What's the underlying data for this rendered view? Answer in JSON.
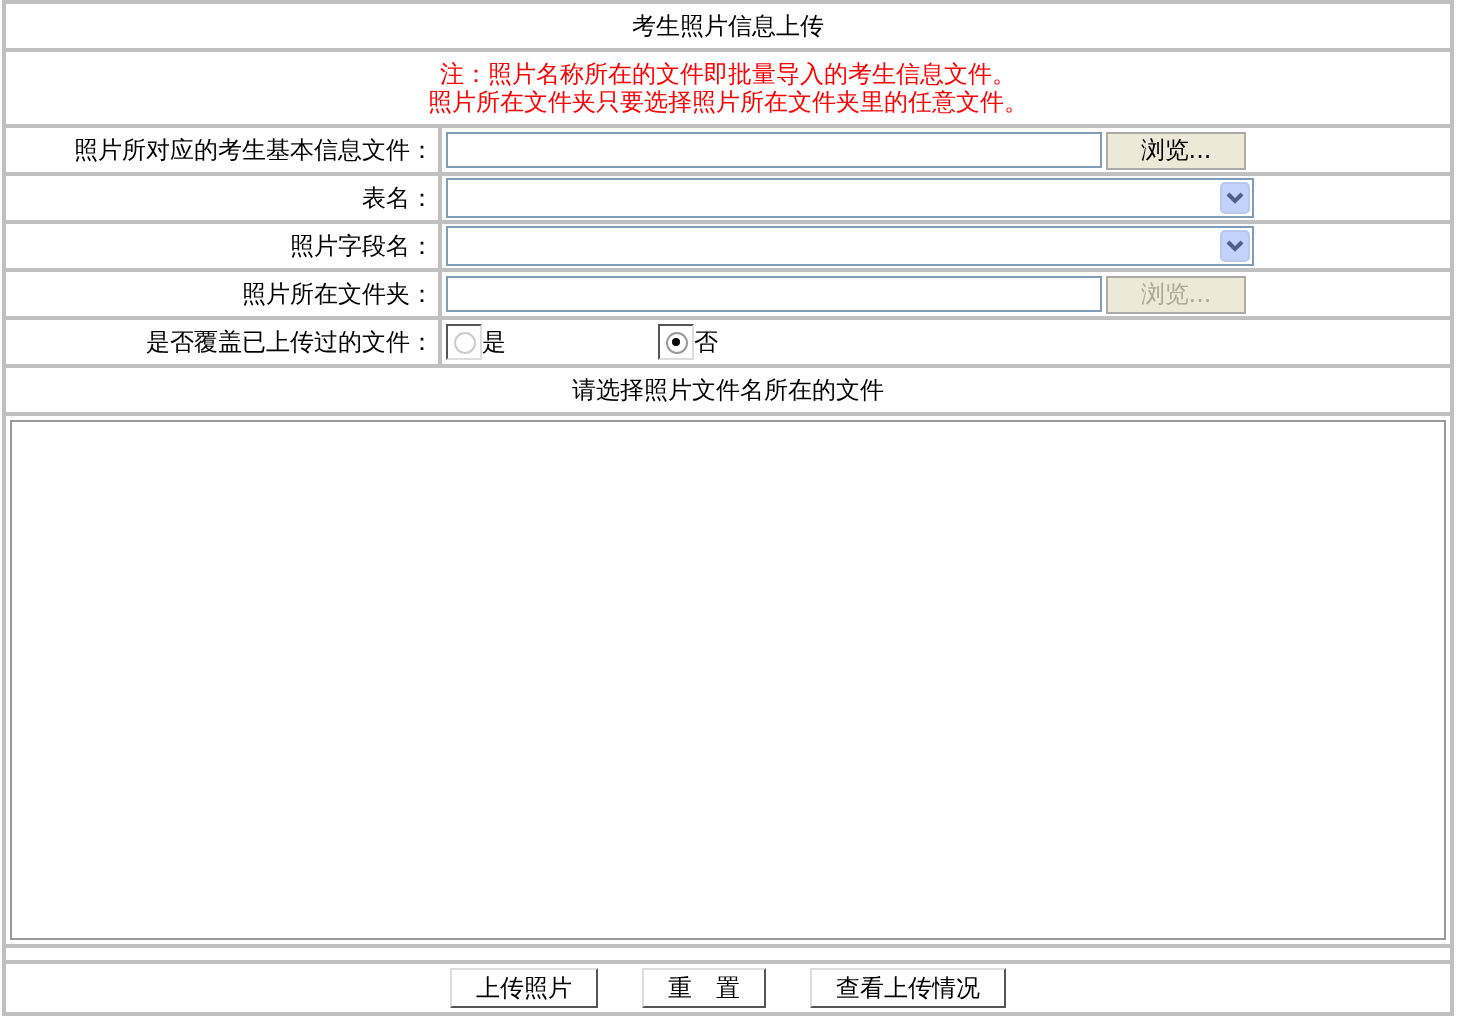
{
  "title": "考生照片信息上传",
  "notes": [
    "注：照片名称所在的文件即批量导入的考生信息文件。",
    "照片所在文件夹只要选择照片所在文件夹里的任意文件。"
  ],
  "fields": [
    {
      "kind": "file",
      "label": "照片所对应的考生基本信息文件：",
      "button": "浏览...",
      "disabled": false
    },
    {
      "kind": "select",
      "label": "表名："
    },
    {
      "kind": "select",
      "label": "照片字段名："
    },
    {
      "kind": "file",
      "label": "照片所在文件夹：",
      "button": "浏览...",
      "disabled": true
    },
    {
      "kind": "radio",
      "label": "是否覆盖已上传过的文件：",
      "options": [
        {
          "label": "是",
          "selected": false
        },
        {
          "label": "否",
          "selected": true
        }
      ]
    }
  ],
  "list_header": "请选择照片文件名所在的文件",
  "buttons": [
    "上传照片",
    "重　置",
    "查看上传情况"
  ]
}
